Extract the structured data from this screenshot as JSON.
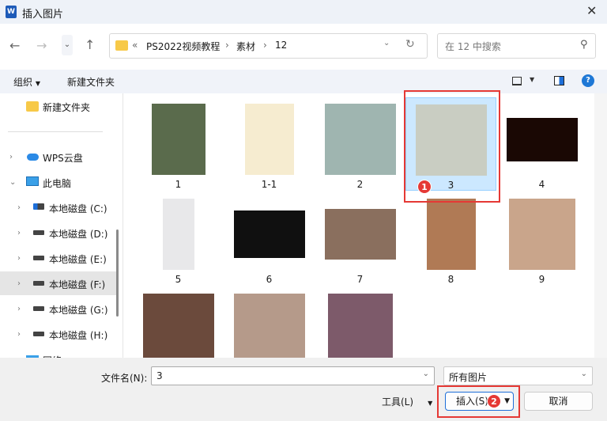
{
  "title": "插入图片",
  "address": {
    "overflow": "«",
    "crumbs": [
      "PS2022视频教程",
      "素材",
      "12"
    ]
  },
  "search": {
    "placeholder": "在 12 中搜索"
  },
  "toolbar": {
    "organize": "组织",
    "new_folder": "新建文件夹"
  },
  "sidebar": {
    "new_folder": "新建文件夹",
    "items": [
      {
        "label": "WPS云盘"
      },
      {
        "label": "此电脑"
      },
      {
        "label": "本地磁盘 (C:)"
      },
      {
        "label": "本地磁盘 (D:)"
      },
      {
        "label": "本地磁盘 (E:)"
      },
      {
        "label": "本地磁盘 (F:)",
        "selected": true
      },
      {
        "label": "本地磁盘 (G:)"
      },
      {
        "label": "本地磁盘 (H:)"
      },
      {
        "label": "网络"
      }
    ]
  },
  "files": [
    {
      "name": "1",
      "color": "#5a6b4c"
    },
    {
      "name": "1-1",
      "color": "#f6ecd0"
    },
    {
      "name": "2",
      "color": "#9fb5b0"
    },
    {
      "name": "3",
      "color": "#c9cdc2",
      "selected": true
    },
    {
      "name": "4",
      "color": "#1a0804"
    },
    {
      "name": "5",
      "color": "#e8e8ea"
    },
    {
      "name": "6",
      "color": "#101010"
    },
    {
      "name": "7",
      "color": "#8a6f5e"
    },
    {
      "name": "8",
      "color": "#b07a55"
    },
    {
      "name": "9",
      "color": "#c9a58b"
    },
    {
      "name": "",
      "color": "#6b4a3c"
    },
    {
      "name": "",
      "color": "#b59a8a"
    },
    {
      "name": "",
      "color": "#7d5a6a"
    }
  ],
  "annotations": [
    "1",
    "2"
  ],
  "bottom": {
    "filename_label": "文件名(N):",
    "filename_value": "3",
    "filter": "所有图片",
    "tools": "工具(L)",
    "insert": "插入(S)",
    "cancel": "取消"
  }
}
